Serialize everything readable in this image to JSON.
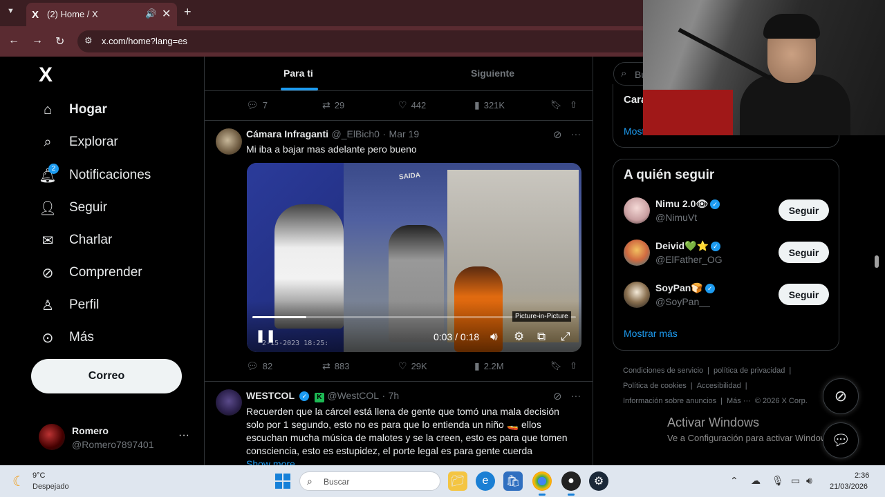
{
  "browser": {
    "tab_title": "(2) Home / X",
    "tab_favicon": "X",
    "url": "x.com/home?lang=es"
  },
  "nav": {
    "logo": "X",
    "items": [
      {
        "label": "Hogar",
        "icon": "home-icon",
        "active": true
      },
      {
        "label": "Explorar",
        "icon": "search-icon"
      },
      {
        "label": "Notificaciones",
        "icon": "bell-icon",
        "badge": "2"
      },
      {
        "label": "Seguir",
        "icon": "person-plus-icon"
      },
      {
        "label": "Charlar",
        "icon": "mail-icon"
      },
      {
        "label": "Comprender",
        "icon": "grok-icon"
      },
      {
        "label": "Perfil",
        "icon": "person-icon"
      },
      {
        "label": "Más",
        "icon": "more-circle-icon"
      }
    ],
    "post_button": "Correo",
    "account": {
      "name": "Romero",
      "handle": "@Romero7897401"
    }
  },
  "timeline": {
    "tabs": [
      "Para ti",
      "Siguiente"
    ],
    "active_tab": "Para ti",
    "prev_post_stats": {
      "replies": "7",
      "reposts": "29",
      "likes": "442",
      "views": "321K"
    },
    "post1": {
      "author": "Cámara Infraganti",
      "handle": "@_ElBich0",
      "time": "Mar 19",
      "text": "Mi iba a bajar mas adelante pero bueno",
      "video": {
        "time_display": "0:03 / 0:18",
        "progress": 0.167,
        "tooltip": "Picture-in-Picture",
        "stamp": "2-15-2023 18:25:",
        "sign": "SAIDA"
      },
      "stats": {
        "replies": "82",
        "reposts": "883",
        "likes": "29K",
        "views": "2.2M"
      }
    },
    "post2": {
      "author": "WESTCOL",
      "affiliate_badge": "K",
      "handle": "@WestCOL",
      "time": "7h",
      "text_lines": [
        "Recuerden que la cárcel está llena de gente que tomó una mala decisión",
        "solo por 1 segundo, esto no es para que lo entienda un niño 🚤 ellos",
        "escuchan mucha música de malotes y se la creen, esto es para que tomen",
        "consciencia, esto es estupidez, el porte legal es para gente cuerda"
      ],
      "show_more": "Show more"
    }
  },
  "right": {
    "search_placeholder": "Bu",
    "card_top_title": "Cara",
    "card_top_more": "Most",
    "who_to_follow": {
      "title": "A quién seguir",
      "users": [
        {
          "name": "Nimu 2.0👁",
          "handle": "@NimuVt",
          "button": "Seguir"
        },
        {
          "name": "Deivid💚⭐",
          "handle": "@ElFather_OG",
          "button": "Seguir"
        },
        {
          "name": "SoyPan🍞",
          "handle": "@SoyPan__",
          "button": "Seguir"
        }
      ],
      "show_more": "Mostrar más"
    },
    "footer": {
      "line1": [
        "Condiciones de servicio",
        "|",
        "política de privacidad",
        "|"
      ],
      "line2": [
        "Política de cookies",
        "|",
        "Accesibilidad",
        "|"
      ],
      "line3": [
        "Información sobre anuncios",
        "|",
        "Más ···",
        "© 2026 X Corp."
      ]
    }
  },
  "windows_activation": {
    "title": "Activar Windows",
    "subtitle": "Ve a Configuración para activar Windows."
  },
  "taskbar": {
    "weather_temp": "9°C",
    "weather_desc": "Despejado",
    "search_placeholder": "Buscar",
    "time": "2:36",
    "date": "21/03/2026"
  },
  "colors": {
    "accent": "#1d9bf0",
    "background": "#000000",
    "browser_frame": "#5a2b31"
  }
}
